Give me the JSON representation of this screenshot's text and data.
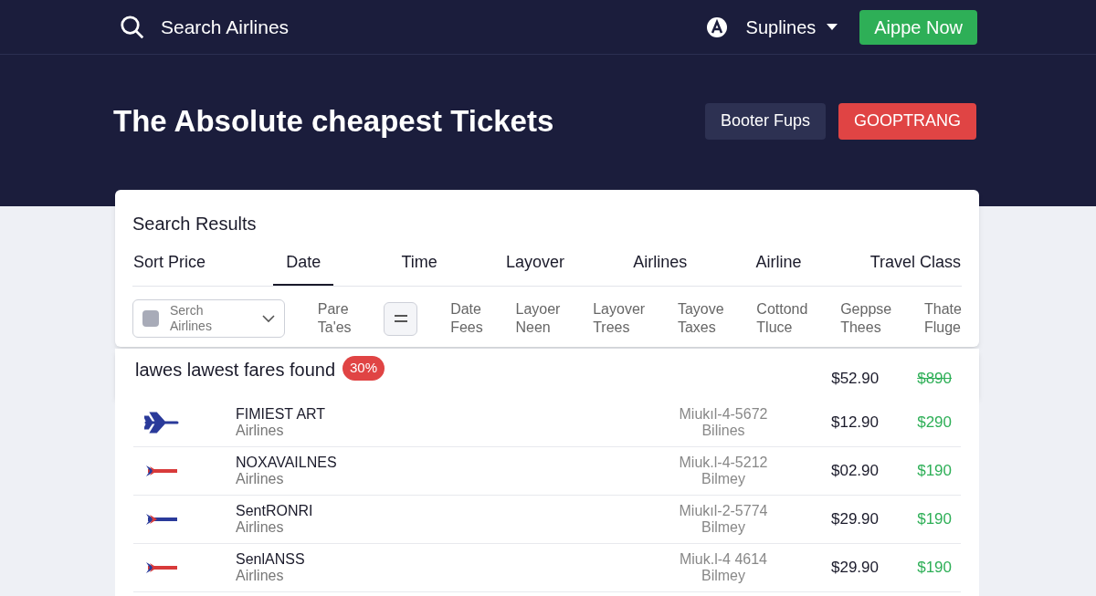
{
  "nav": {
    "search_label": "Search Airlines",
    "account": "Suplines",
    "cta": "Aippe Now"
  },
  "hero": {
    "title": "The Absolute cheapest Tickets",
    "buttons": [
      {
        "label": "Booter Fups",
        "kind": "secondary"
      },
      {
        "label": "GOOPTRANG",
        "kind": "danger"
      }
    ]
  },
  "results": {
    "title": "Search Results",
    "tabs": [
      {
        "label": "Sort Price",
        "selected": false
      },
      {
        "label": "Date",
        "selected": true
      },
      {
        "label": "Time",
        "selected": false
      },
      {
        "label": "Layover",
        "selected": false
      },
      {
        "label": "Airlines",
        "selected": false
      },
      {
        "label": "Airline",
        "selected": false
      },
      {
        "label": "Travel Class",
        "selected": false
      }
    ],
    "filter_select": {
      "placeholder": [
        "Serch",
        "Airlines"
      ]
    },
    "filters": [
      {
        "kind": "text",
        "lines": [
          "Pare",
          "Ta'es"
        ]
      },
      {
        "kind": "icon-button"
      },
      {
        "kind": "text",
        "lines": [
          "Date",
          "Fees"
        ]
      },
      {
        "kind": "text",
        "lines": [
          "Layoer",
          "Neen"
        ]
      },
      {
        "kind": "text",
        "lines": [
          "Layover",
          "Trees"
        ]
      },
      {
        "kind": "text",
        "lines": [
          "Tayove",
          "Taxes"
        ]
      },
      {
        "kind": "text",
        "lines": [
          "Cottond",
          "Tluce"
        ]
      },
      {
        "kind": "text",
        "lines": [
          "Geppse",
          "Thees"
        ]
      },
      {
        "kind": "text",
        "lines": [
          "Thate",
          "Fluge"
        ]
      }
    ]
  },
  "summary": {
    "text": "lawes lawest fares found",
    "badge": "30%",
    "price": "$52.90",
    "old_price": "$890"
  },
  "flights": [
    {
      "kind": "plane",
      "name": "FIMIEST ART",
      "sub": "Airlines",
      "code": "Miukıl-4-5672",
      "code_sub": "Bilines",
      "price": "$12.90",
      "fare": "$290"
    },
    {
      "kind": "stripe",
      "color": "#d83a3a",
      "name": "NOXAVAILNES",
      "sub": "Airlines",
      "code": "Miuk.l-4-5212",
      "code_sub": "Bilmey",
      "price": "$02.90",
      "fare": "$190"
    },
    {
      "kind": "stripe",
      "color": "#2a3a9a",
      "name": "SentRONRI",
      "sub": "Airlines",
      "code": "Miukıl-2-5774",
      "code_sub": "Bilmey",
      "price": "$29.90",
      "fare": "$190"
    },
    {
      "kind": "stripe",
      "color": "#d83a3a",
      "name": "SenlANSS",
      "sub": "Airlines",
      "code": "Miuk.l-4 4614",
      "code_sub": "Bilmey",
      "price": "$29.90",
      "fare": "$190"
    }
  ]
}
